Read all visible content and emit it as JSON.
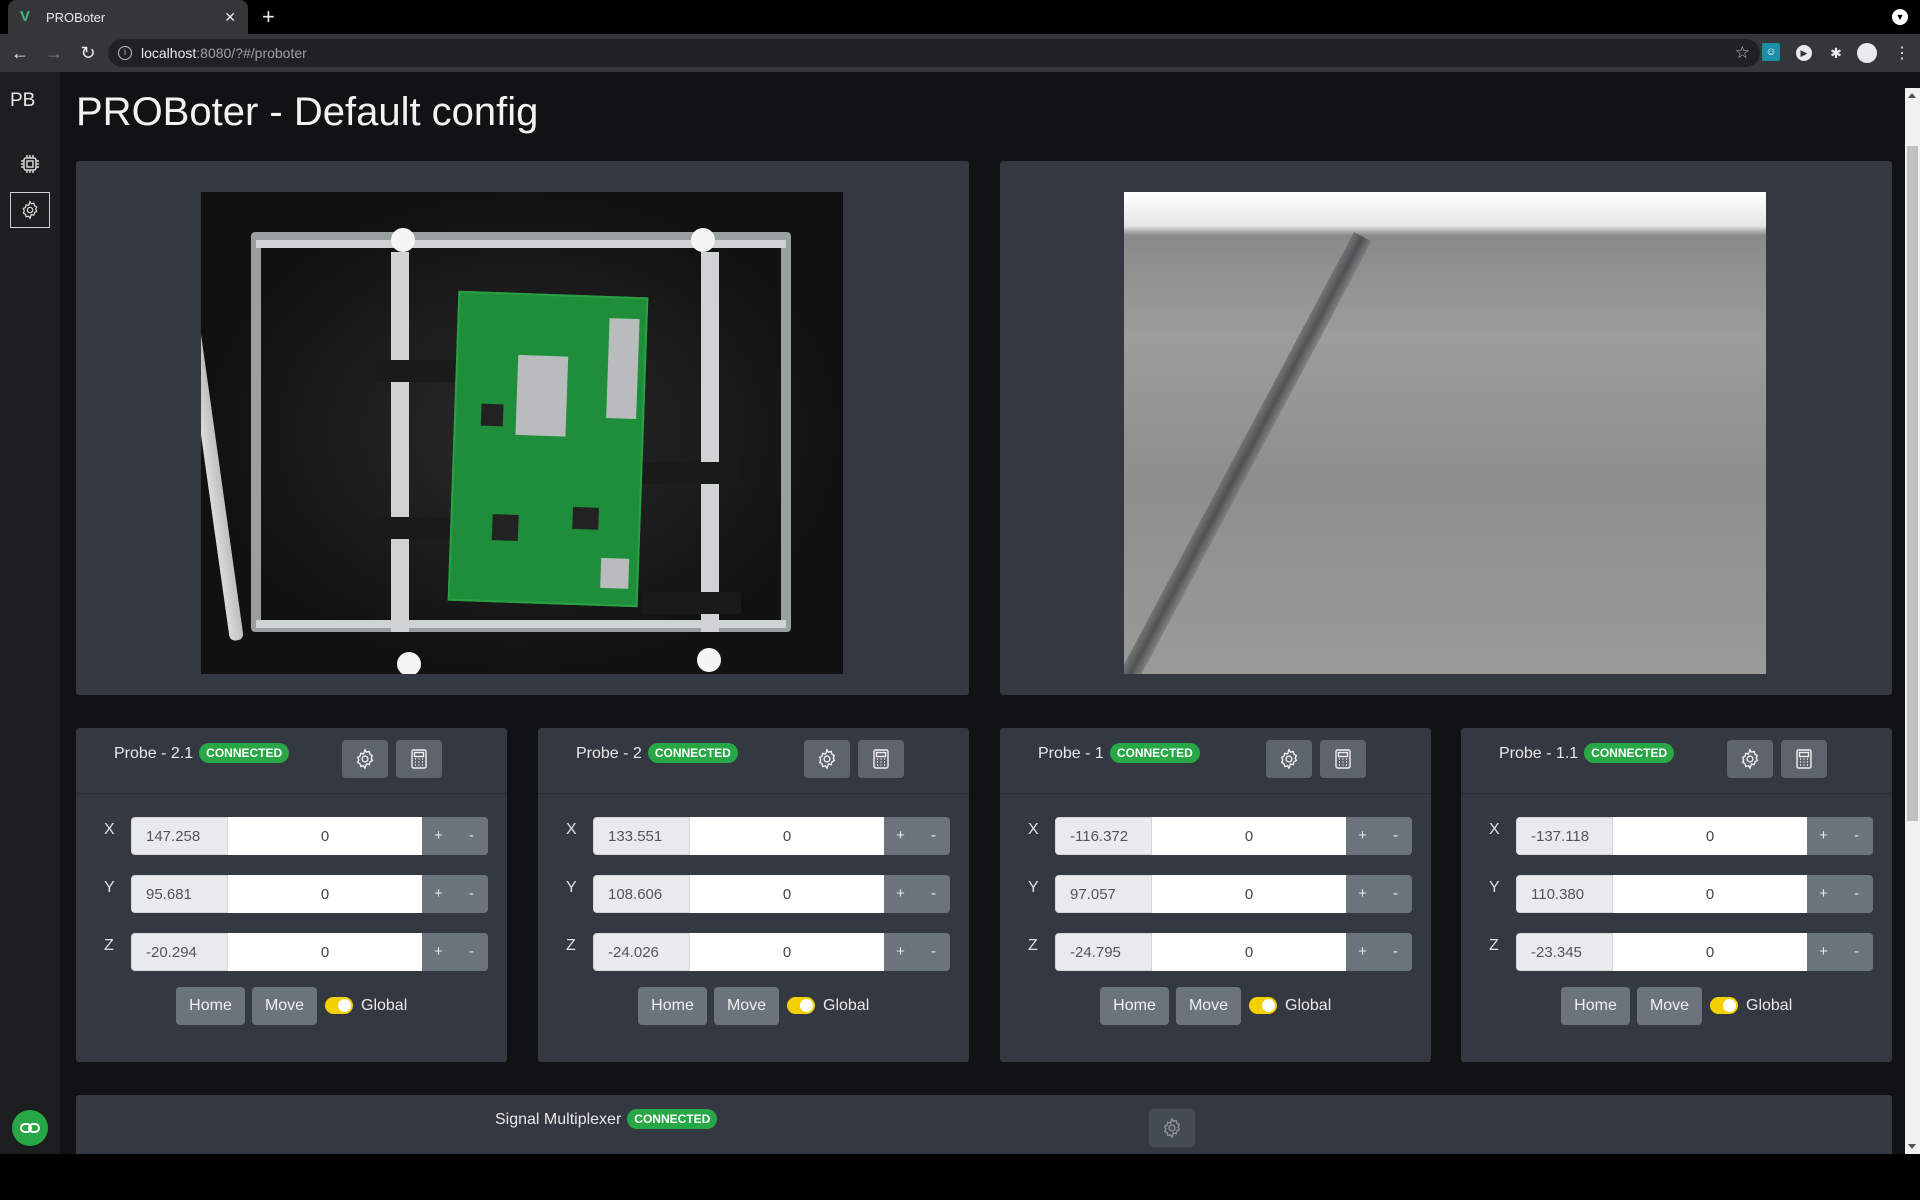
{
  "browser": {
    "tab_title": "PROBoter",
    "url_host": "localhost",
    "url_path": ":8080/?#/proboter"
  },
  "sidebar": {
    "brand": "PB",
    "items": [
      {
        "name": "hardware",
        "icon": "chip-icon",
        "active": false
      },
      {
        "name": "settings",
        "icon": "gear-icon",
        "active": true
      }
    ],
    "connection_icon": "link-icon",
    "connection_color": "#27a745"
  },
  "page": {
    "title": "PROBoter - Default config"
  },
  "cameras": [
    {
      "name": "static-camera",
      "view": "top-down PCB view"
    },
    {
      "name": "probe-camera",
      "view": "close-up probe view"
    }
  ],
  "probes": [
    {
      "name": "Probe - 2.1",
      "status": "CONNECTED",
      "axes": [
        {
          "label": "X",
          "current": "147.258",
          "step": "0"
        },
        {
          "label": "Y",
          "current": "95.681",
          "step": "0"
        },
        {
          "label": "Z",
          "current": "-20.294",
          "step": "0"
        }
      ]
    },
    {
      "name": "Probe - 2",
      "status": "CONNECTED",
      "axes": [
        {
          "label": "X",
          "current": "133.551",
          "step": "0"
        },
        {
          "label": "Y",
          "current": "108.606",
          "step": "0"
        },
        {
          "label": "Z",
          "current": "-24.026",
          "step": "0"
        }
      ]
    },
    {
      "name": "Probe - 1",
      "status": "CONNECTED",
      "axes": [
        {
          "label": "X",
          "current": "-116.372",
          "step": "0"
        },
        {
          "label": "Y",
          "current": "97.057",
          "step": "0"
        },
        {
          "label": "Z",
          "current": "-24.795",
          "step": "0"
        }
      ]
    },
    {
      "name": "Probe - 1.1",
      "status": "CONNECTED",
      "axes": [
        {
          "label": "X",
          "current": "-137.118",
          "step": "0"
        },
        {
          "label": "Y",
          "current": "110.380",
          "step": "0"
        },
        {
          "label": "Z",
          "current": "-23.345",
          "step": "0"
        }
      ]
    }
  ],
  "probe_controls": {
    "plus": "+",
    "minus": "-",
    "home": "Home",
    "move": "Move",
    "global_label": "Global",
    "global_on": true
  },
  "multiplexer": {
    "name": "Signal Multiplexer",
    "status": "CONNECTED"
  },
  "colors": {
    "connected": "#27a745",
    "toggle_on": "#f5d000",
    "panel": "#343840",
    "background": "#111214"
  }
}
